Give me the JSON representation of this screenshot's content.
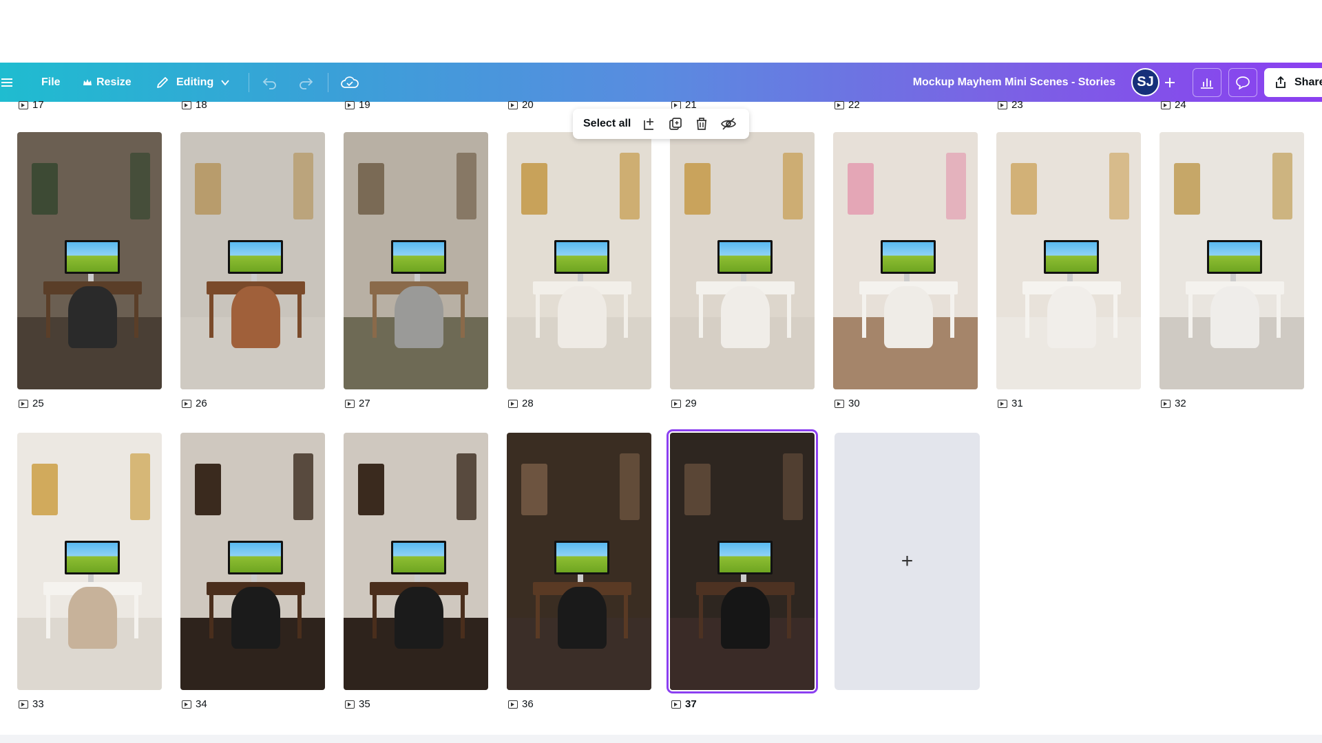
{
  "toolbar": {
    "file_label": "File",
    "resize_label": "Resize",
    "editing_label": "Editing",
    "title": "Mockup Mayhem Mini Scenes - Stories",
    "avatar_initials": "SJ",
    "share_label": "Share"
  },
  "selection_toolbar": {
    "select_all_label": "Select all"
  },
  "top_row_labels": [
    "17",
    "18",
    "19",
    "20",
    "21",
    "22",
    "23",
    "24"
  ],
  "pages": [
    {
      "num": "25",
      "wall": "#6b5f52",
      "floor": "#4a3f35",
      "desk": "#5a3e28",
      "chair": "#2a2a2a",
      "deco": "#3d4a34"
    },
    {
      "num": "26",
      "wall": "#c9c4bc",
      "floor": "#cfcac2",
      "desk": "#7a4a2a",
      "chair": "#a0603a",
      "deco": "#b89c6c"
    },
    {
      "num": "27",
      "wall": "#b8b0a4",
      "floor": "#6e6a55",
      "desk": "#8a6a4a",
      "chair": "#9a9a98",
      "deco": "#7a6a55"
    },
    {
      "num": "28",
      "wall": "#e3ddd3",
      "floor": "#d9d3c9",
      "desk": "#f2efe9",
      "chair": "#efebe5",
      "deco": "#c8a25a"
    },
    {
      "num": "29",
      "wall": "#ddd6cc",
      "floor": "#d6cfc5",
      "desk": "#f3f1ec",
      "chair": "#f0ede8",
      "deco": "#c9a35c"
    },
    {
      "num": "30",
      "wall": "#e7e0d8",
      "floor": "#a5856a",
      "desk": "#f4f2ee",
      "chair": "#efece7",
      "deco": "#e4a6b6"
    },
    {
      "num": "31",
      "wall": "#e8e2da",
      "floor": "#ece8e2",
      "desk": "#f5f3ef",
      "chair": "#f1eeea",
      "deco": "#d2b177"
    },
    {
      "num": "32",
      "wall": "#e9e5df",
      "floor": "#cfcac3",
      "desk": "#f4f2ee",
      "chair": "#efedea",
      "deco": "#c6a768"
    },
    {
      "num": "33",
      "wall": "#ece8e2",
      "floor": "#ddd8d0",
      "desk": "#f5f3ef",
      "chair": "#c7b29a",
      "deco": "#d1aa5c"
    },
    {
      "num": "34",
      "wall": "#cfc8bf",
      "floor": "#2e231c",
      "desk": "#4a2e1c",
      "chair": "#1b1b1b",
      "deco": "#3a2a1e"
    },
    {
      "num": "35",
      "wall": "#cfc8bf",
      "floor": "#2e231c",
      "desk": "#4a2e1c",
      "chair": "#1b1b1b",
      "deco": "#3a2a1e"
    },
    {
      "num": "36",
      "wall": "#3a2d22",
      "floor": "#3b2e28",
      "desk": "#5a3a24",
      "chair": "#1a1a1a",
      "deco": "#6d5440"
    },
    {
      "num": "37",
      "wall": "#2e2620",
      "floor": "#3a2b27",
      "desk": "#4d3222",
      "chair": "#161616",
      "deco": "#5a4636",
      "selected": true
    }
  ],
  "add_page_symbol": "+",
  "colors": {
    "accent": "#8b3ff0",
    "avatar": "#16307a"
  }
}
